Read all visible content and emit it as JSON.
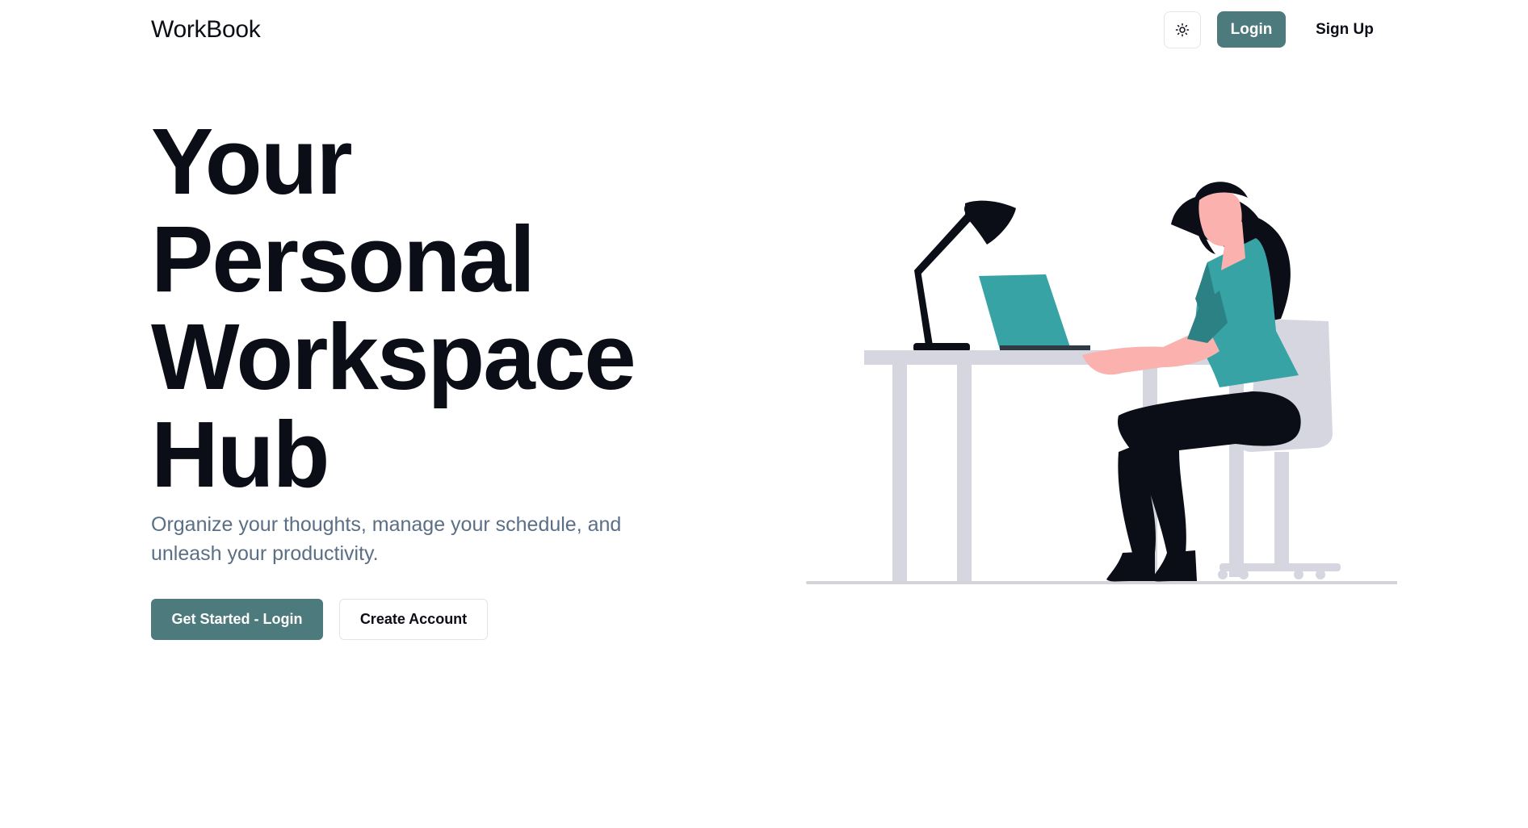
{
  "nav": {
    "brand": "WorkBook",
    "theme_icon": "sun-icon",
    "login_label": "Login",
    "signup_label": "Sign Up"
  },
  "hero": {
    "title_lines": [
      "Your",
      "Personal",
      "Workspace",
      "Hub"
    ],
    "subtitle": "Organize your thoughts, manage your schedule, and unleash your productivity.",
    "primary_cta": "Get Started - Login",
    "secondary_cta": "Create Account"
  },
  "illustration": {
    "subject": "woman-working-at-desk-illustration"
  },
  "colors": {
    "accent": "#4d7a7d",
    "text": "#0b0d17",
    "muted_text": "#5a6f85",
    "laptop": "#38a3a5",
    "furniture": "#d6d6e0"
  }
}
